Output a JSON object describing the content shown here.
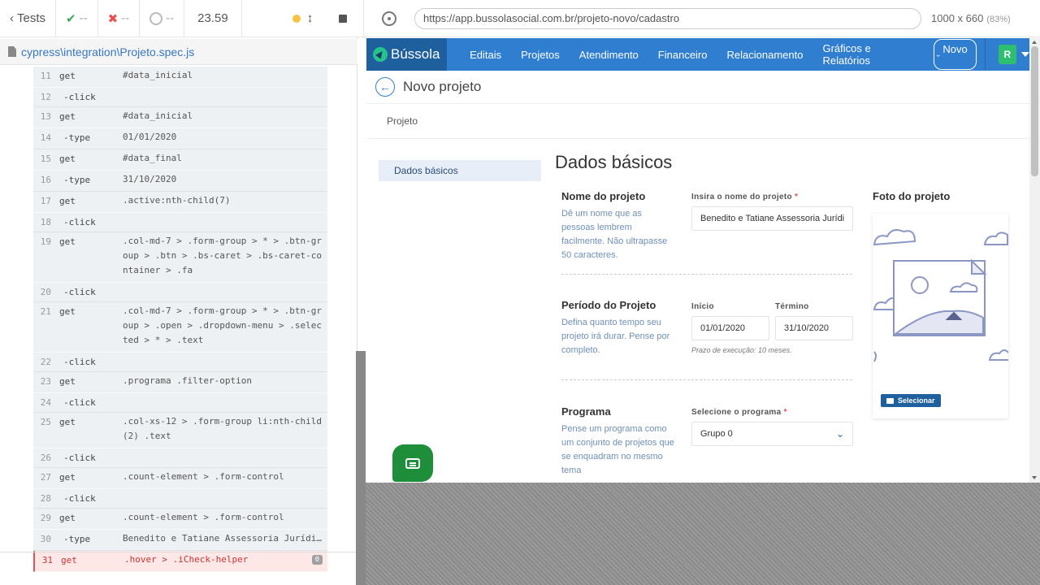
{
  "runner": {
    "tests_label": "Tests",
    "passed": "--",
    "failed": "--",
    "pending": "--",
    "duration": "23.59",
    "spec_path": "cypress\\integration\\Projeto.spec.js"
  },
  "commands": [
    {
      "n": "11",
      "cmd": "get",
      "msg": "#data_inicial",
      "child": false
    },
    {
      "n": "12",
      "cmd": "-click",
      "msg": "",
      "child": true
    },
    {
      "n": "13",
      "cmd": "get",
      "msg": "#data_inicial",
      "child": false
    },
    {
      "n": "14",
      "cmd": "-type",
      "msg": "01/01/2020",
      "child": true
    },
    {
      "n": "15",
      "cmd": "get",
      "msg": "#data_final",
      "child": false
    },
    {
      "n": "16",
      "cmd": "-type",
      "msg": "31/10/2020",
      "child": true
    },
    {
      "n": "17",
      "cmd": "get",
      "msg": ".active:nth-child(7)",
      "child": false
    },
    {
      "n": "18",
      "cmd": "-click",
      "msg": "",
      "child": true
    },
    {
      "n": "19",
      "cmd": "get",
      "msg": ".col-md-7 > .form-group > * > .btn-group > .btn > .bs-caret > .bs-caret-container > .fa",
      "child": false
    },
    {
      "n": "20",
      "cmd": "-click",
      "msg": "",
      "child": true
    },
    {
      "n": "21",
      "cmd": "get",
      "msg": ".col-md-7 > .form-group > * > .btn-group > .open > .dropdown-menu > .selected > * > .text",
      "child": false
    },
    {
      "n": "22",
      "cmd": "-click",
      "msg": "",
      "child": true
    },
    {
      "n": "23",
      "cmd": "get",
      "msg": ".programa .filter-option",
      "child": false
    },
    {
      "n": "24",
      "cmd": "-click",
      "msg": "",
      "child": true
    },
    {
      "n": "25",
      "cmd": "get",
      "msg": ".col-xs-12 > .form-group li:nth-child(2) .text",
      "child": false
    },
    {
      "n": "26",
      "cmd": "-click",
      "msg": "",
      "child": true
    },
    {
      "n": "27",
      "cmd": "get",
      "msg": ".count-element > .form-control",
      "child": false
    },
    {
      "n": "28",
      "cmd": "-click",
      "msg": "",
      "child": true
    },
    {
      "n": "29",
      "cmd": "get",
      "msg": ".count-element > .form-control",
      "child": false
    },
    {
      "n": "30",
      "cmd": "-type",
      "msg": "Benedito e Tatiane Assessoria Jurídi…",
      "child": true
    }
  ],
  "failed_command": {
    "n": "31",
    "cmd": "get",
    "msg": ".hover > .iCheck-helper",
    "badge": "0"
  },
  "browser": {
    "url": "https://app.bussolasocial.com.br/projeto-novo/cadastro",
    "viewport": "1000 x 660",
    "zoom": "(83%)"
  },
  "app": {
    "brand": "Bússola",
    "nav": [
      "Editais",
      "Projetos",
      "Atendimento",
      "Financeiro",
      "Relacionamento",
      "Gráficos e Relatórios"
    ],
    "new_button": "Novo",
    "new_caret": "ˇ",
    "avatar": "R",
    "page_title": "Novo projeto",
    "breadcrumb": "Projeto",
    "side_item": "Dados básicos",
    "section_title": "Dados básicos",
    "nome": {
      "label": "Nome do projeto",
      "help": "Dê um nome que as pessoas lembrem facilmente. Não ultrapasse 50 caracteres.",
      "field_label": "Insira o nome do projeto",
      "value": "Benedito e Tatiane Assessoria Jurídi"
    },
    "periodo": {
      "label": "Período do Projeto",
      "help": "Defina quanto tempo seu projeto irá durar. Pense por completo.",
      "inicio_label": "Início",
      "inicio_value": "01/01/2020",
      "termino_label": "Término",
      "termino_value": "31/10/2020",
      "hint": "Prazo de execução: 10 meses."
    },
    "programa": {
      "label": "Programa",
      "help": "Pense um programa como um conjunto de projetos que se enquadram no mesmo tema",
      "field_label": "Selecione o programa",
      "value": "Grupo 0"
    },
    "foto": {
      "label": "Foto do projeto",
      "button": "Selecionar"
    },
    "required_mark": "*"
  }
}
